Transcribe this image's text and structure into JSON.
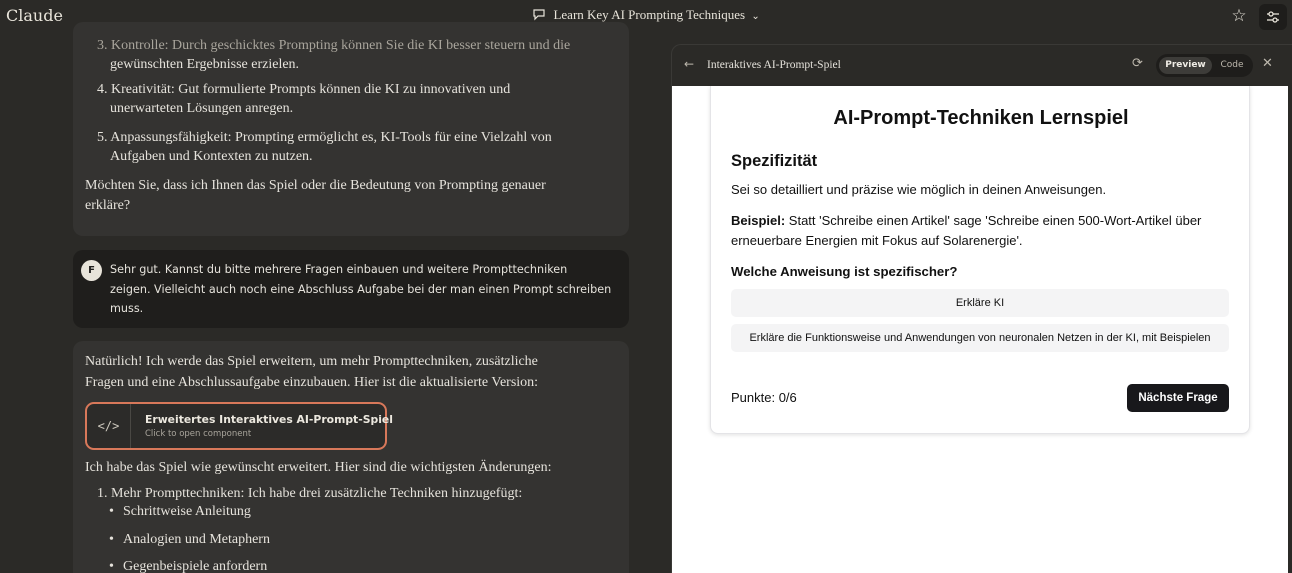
{
  "app": {
    "logo": "Claude"
  },
  "header": {
    "title": "Learn Key AI Prompting Techniques",
    "chevron": "⌄",
    "star_icon": "star-icon",
    "settings_icon": "sliders-icon"
  },
  "chat": {
    "ai_msg_1": {
      "list": [
        {
          "line1": "3. Kontrolle: Durch geschicktes Prompting können Sie die KI besser steuern und die",
          "line2": "gewünschten Ergebnisse erzielen."
        },
        {
          "line1": "4. Kreativität: Gut formulierte Prompts können die KI zu innovativen und",
          "line2": "unerwarteten Lösungen anregen."
        },
        {
          "line1": "5. Anpassungsfähigkeit: Prompting ermöglicht es, KI-Tools für eine Vielzahl von",
          "line2": "Aufgaben und Kontexten zu nutzen."
        }
      ],
      "closing_1": "Möchten Sie, dass ich Ihnen das Spiel oder die Bedeutung von Prompting genauer",
      "closing_2": "erkläre?"
    },
    "user_msg": {
      "avatar": "F",
      "line1": "Sehr gut. Kannst du bitte mehrere Fragen einbauen und weitere Prompttechniken",
      "line2": "zeigen. Vielleicht auch noch eine Abschluss Aufgabe bei der man einen Prompt schreiben",
      "line3": "muss."
    },
    "ai_msg_2": {
      "intro_1": "Natürlich! Ich werde das Spiel erweitern, um mehr Prompttechniken, zusätzliche",
      "intro_2": "Fragen und eine Abschlussaufgabe einzubauen. Hier ist die aktualisierte Version:",
      "artifact": {
        "icon": "</>",
        "title": "Erweitertes Interaktives AI-Prompt-Spiel",
        "subtitle": "Click to open component"
      },
      "summary": "Ich habe das Spiel wie gewünscht erweitert. Hier sind die wichtigsten Änderungen:",
      "list_item_1": "1. Mehr Prompttechniken: Ich habe drei zusätzliche Techniken hinzugefügt:",
      "bullets": [
        "Schrittweise Anleitung",
        "Analogien und Metaphern",
        "Gegenbeispiele anfordern"
      ]
    }
  },
  "panel": {
    "back_icon": "←",
    "title": "Interaktives AI-Prompt-Spiel",
    "refresh_icon": "⟳",
    "tabs": {
      "preview": "Preview",
      "code": "Code"
    },
    "close_icon": "✕"
  },
  "game": {
    "title": "AI-Prompt-Techniken Lernspiel",
    "section": "Spezifizität",
    "description": "Sei so detailliert und präzise wie möglich in deinen Anweisungen.",
    "example_label": "Beispiel:",
    "example_line1": " Statt 'Schreibe einen Artikel' sage 'Schreibe einen 500-Wort-Artikel über",
    "example_line2": "erneuerbare Energien mit Fokus auf Solarenergie'.",
    "question": "Welche Anweisung ist spezifischer?",
    "options": [
      "Erkläre KI",
      "Erkläre die Funktionsweise und Anwendungen von neuronalen Netzen in der KI, mit Beispielen"
    ],
    "score": "Punkte: 0/6",
    "next_button": "Nächste Frage"
  }
}
